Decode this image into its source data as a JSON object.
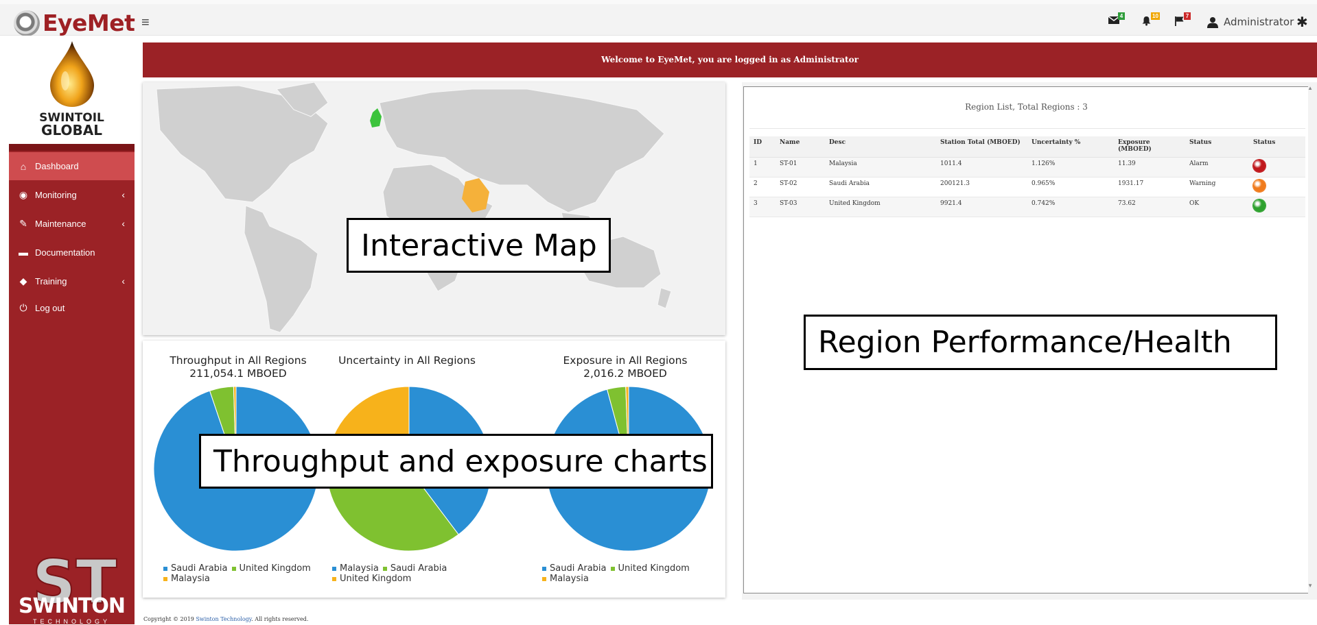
{
  "brand": {
    "app_name": "EyeMet",
    "company_line1": "SWINTOIL",
    "company_line2": "GLOBAL",
    "footer_logo": "SWINTON",
    "footer_logo_sub": "TECHNOLOGY"
  },
  "topbar": {
    "menu_icon": "hamburger-icon",
    "mail_count": "4",
    "notification_count": "10",
    "flag_count": "7",
    "user_name": "Administrator",
    "icons": [
      "envelope-icon",
      "bell-icon",
      "flag-icon",
      "user-icon",
      "gear-icon"
    ],
    "badge_colors": {
      "mail": "#2e9c3a",
      "notification": "#f0a600",
      "flag": "#cc2a2a"
    }
  },
  "sidebar": {
    "items": [
      {
        "label": "Dashboard",
        "icon": "home-icon",
        "active": true,
        "has_submenu": false
      },
      {
        "label": "Monitoring",
        "icon": "eye-icon",
        "active": false,
        "has_submenu": true
      },
      {
        "label": "Maintenance",
        "icon": "wrench-icon",
        "active": false,
        "has_submenu": true
      },
      {
        "label": "Documentation",
        "icon": "folder-icon",
        "active": false,
        "has_submenu": false
      },
      {
        "label": "Training",
        "icon": "graduation-cap-icon",
        "active": false,
        "has_submenu": true
      },
      {
        "label": "Log out",
        "icon": "power-icon",
        "active": false,
        "has_submenu": false
      }
    ],
    "colors": {
      "background": "#9b2226",
      "active": "#cf4c4f"
    }
  },
  "welcome_banner": "Welcome to EyeMet, you are logged in as Administrator",
  "map": {
    "highlighted_regions": [
      {
        "name": "United Kingdom",
        "color": "#3cc33c"
      },
      {
        "name": "Saudi Arabia",
        "color": "#f5b13a"
      },
      {
        "name": "Malaysia",
        "color": "#d23b3b"
      }
    ]
  },
  "charts": [
    {
      "title": "Throughput in All Regions",
      "subtitle": "211,054.1 MBOED",
      "legend": [
        "Saudi Arabia",
        "United Kingdom",
        "Malaysia"
      ]
    },
    {
      "title": "Uncertainty in All Regions",
      "subtitle": "",
      "legend": [
        "Malaysia",
        "Saudi Arabia",
        "United Kingdom"
      ]
    },
    {
      "title": "Exposure in All Regions",
      "subtitle": "2,016.2 MBOED",
      "legend": [
        "Saudi Arabia",
        "United Kingdom",
        "Malaysia"
      ]
    }
  ],
  "chart_data": [
    {
      "type": "pie",
      "title": "Throughput in All Regions",
      "subtitle": "211,054.1 MBOED",
      "categories": [
        "Saudi Arabia",
        "United Kingdom",
        "Malaysia"
      ],
      "values": [
        200121.3,
        9921.4,
        1011.4
      ],
      "colors": [
        "#2a8fd4",
        "#7fc130",
        "#f7b21b"
      ],
      "legend": "bottom"
    },
    {
      "type": "pie",
      "title": "Uncertainty in All Regions",
      "categories": [
        "Malaysia",
        "Saudi Arabia",
        "United Kingdom"
      ],
      "values": [
        1.126,
        0.965,
        0.742
      ],
      "colors": [
        "#2a8fd4",
        "#7fc130",
        "#f7b21b"
      ],
      "legend": "bottom"
    },
    {
      "type": "pie",
      "title": "Exposure in All Regions",
      "subtitle": "2,016.2 MBOED",
      "categories": [
        "Saudi Arabia",
        "United Kingdom",
        "Malaysia"
      ],
      "values": [
        1931.17,
        73.62,
        11.39
      ],
      "colors": [
        "#2a8fd4",
        "#7fc130",
        "#f7b21b"
      ],
      "legend": "bottom"
    }
  ],
  "region_table": {
    "title": "Region List, Total Regions : 3",
    "columns": [
      "ID",
      "Name",
      "Desc",
      "Station Total (MBOED)",
      "Uncertainty %",
      "Exposure (MBOED)",
      "Status",
      "Status"
    ],
    "rows": [
      {
        "id": "1",
        "name": "ST-01",
        "desc": "Malaysia",
        "station_total": "1011.4",
        "uncertainty": "1.126%",
        "exposure": "11.39",
        "status": "Alarm",
        "status_color": "#c0181c"
      },
      {
        "id": "2",
        "name": "ST-02",
        "desc": "Saudi Arabia",
        "station_total": "200121.3",
        "uncertainty": "0.965%",
        "exposure": "1931.17",
        "status": "Warning",
        "status_color": "#f07b1d"
      },
      {
        "id": "3",
        "name": "ST-03",
        "desc": "United Kingdom",
        "station_total": "9921.4",
        "uncertainty": "0.742%",
        "exposure": "73.62",
        "status": "OK",
        "status_color": "#2ea12e"
      }
    ]
  },
  "callouts": {
    "map": "Interactive Map",
    "charts": "Throughput and exposure charts",
    "table": "Region Performance/Health"
  },
  "footer": {
    "prefix": "Copyright © 2019 ",
    "link": "Swinton Technology",
    "suffix": ". All rights reserved."
  }
}
